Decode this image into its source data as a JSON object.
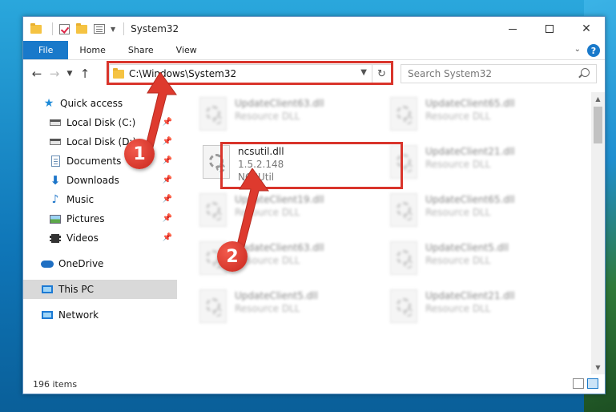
{
  "window": {
    "title": "System32",
    "controls": {
      "minimize": "—",
      "maximize": "",
      "close": "✕"
    }
  },
  "ribbon": {
    "tabs": [
      "File",
      "Home",
      "Share",
      "View"
    ],
    "help": "?"
  },
  "navbar": {
    "path": "C:\\Windows\\System32",
    "search_placeholder": "Search System32"
  },
  "sidebar": {
    "items": [
      {
        "label": "Quick access",
        "icon": "star-icon"
      },
      {
        "label": "Local Disk (C:)",
        "icon": "disk-icon",
        "pinned": true
      },
      {
        "label": "Local Disk (D:)",
        "icon": "disk-icon",
        "pinned": true
      },
      {
        "label": "Documents",
        "icon": "documents-icon",
        "pinned": true
      },
      {
        "label": "Downloads",
        "icon": "download-icon",
        "pinned": true
      },
      {
        "label": "Music",
        "icon": "music-icon",
        "pinned": true
      },
      {
        "label": "Pictures",
        "icon": "pictures-icon",
        "pinned": true
      },
      {
        "label": "Videos",
        "icon": "videos-icon",
        "pinned": true
      },
      {
        "label": "OneDrive",
        "icon": "cloud-icon"
      },
      {
        "label": "This PC",
        "icon": "computer-icon",
        "selected": true
      },
      {
        "label": "Network",
        "icon": "network-icon"
      }
    ]
  },
  "files": [
    {
      "name": "UpdateClient63.dll",
      "sub": "Resource DLL",
      "blurred": true
    },
    {
      "name": "UpdateClient65.dll",
      "sub": "Resource DLL",
      "blurred": true
    },
    {
      "name": "ncsutil.dll",
      "version": "1.5.2.148",
      "sub": "NCSUtil",
      "blurred": false
    },
    {
      "name": "UpdateClient21.dll",
      "sub": "Resource DLL",
      "blurred": true
    },
    {
      "name": "UpdateClient19.dll",
      "sub": "Resource DLL",
      "blurred": true
    },
    {
      "name": "UpdateClient65.dll",
      "sub": "Resource DLL",
      "blurred": true
    },
    {
      "name": "UpdateClient63.dll",
      "sub": "Resource DLL",
      "blurred": true
    },
    {
      "name": "UpdateClient5.dll",
      "sub": "Resource DLL",
      "blurred": true
    },
    {
      "name": "UpdateClient5.dll",
      "sub": "Resource DLL",
      "blurred": true
    },
    {
      "name": "UpdateClient21.dll",
      "sub": "Resource DLL",
      "blurred": true
    }
  ],
  "status": {
    "count": "196 items"
  },
  "markers": {
    "one": "1",
    "two": "2"
  },
  "colors": {
    "accent": "#1979ca",
    "highlight": "#d9342b"
  }
}
